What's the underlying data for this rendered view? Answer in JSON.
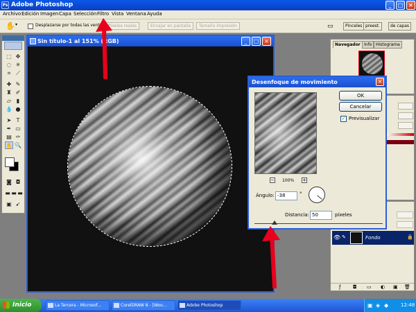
{
  "app": {
    "title": "Adobe Photoshop"
  },
  "menu": [
    "Archivo",
    "Edición",
    "Imagen",
    "Capa",
    "Selección",
    "Filtro",
    "Vista",
    "Ventana",
    "Ayuda"
  ],
  "options": {
    "checkbox_label": "Desplazarse por todas las ventanas",
    "buttons": [
      "Píxeles reales",
      "Encajar en pantalla",
      "Tamaño impresión"
    ],
    "dock_tabs": [
      "Pinceles",
      "preest.",
      "de capas"
    ]
  },
  "document": {
    "title": "Sin título-1 al 151% (RGB)"
  },
  "panels": {
    "navigator_tabs": [
      "Navegador",
      "Info",
      "Histograma"
    ],
    "layer_name": "Fondo"
  },
  "dialog": {
    "title": "Desenfoque de movimiento",
    "ok": "OK",
    "cancel": "Cancelar",
    "preview_label": "Previsualizar",
    "zoom": "100%",
    "angle_label": "Ángulo:",
    "angle_value": "-38",
    "angle_unit": "°",
    "distance_label": "Distancia:",
    "distance_value": "50",
    "distance_unit": "píxeles"
  },
  "taskbar": {
    "start": "Inicio",
    "tasks": [
      "La Tercera - Microsof...",
      "CorelDRAW 8 - [Woo...",
      "Adobe Photoshop"
    ],
    "clock": "12:48"
  },
  "colors": {
    "accent_red": "#e8001c",
    "xp_blue": "#0a4fd6",
    "dialog_bg": "#ece9d8"
  }
}
